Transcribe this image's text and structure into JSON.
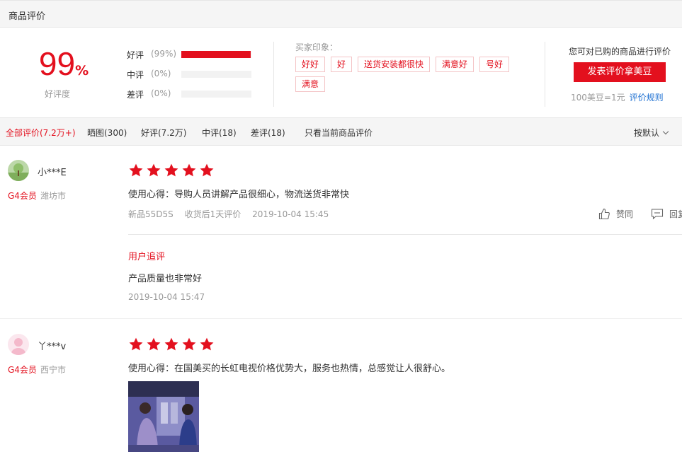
{
  "section_title": "商品评价",
  "summary": {
    "rate_value": "99",
    "rate_unit": "%",
    "rate_label": "好评度",
    "breakdown": [
      {
        "name": "好评",
        "percent_text": "(99%)",
        "fraction": 0.99
      },
      {
        "name": "中评",
        "percent_text": "(0%)",
        "fraction": 0
      },
      {
        "name": "差评",
        "percent_text": "(0%)",
        "fraction": 0
      }
    ],
    "impression_label": "买家印象：",
    "tags": [
      "好好",
      "好",
      "送货安装都很快",
      "满意好",
      "号好",
      "满意"
    ],
    "cta_hint": "您可对已购的商品进行评价",
    "cta_button": "发表评价拿美豆",
    "coin_note": "100美豆=1元",
    "rule_link": "评价规则"
  },
  "filters": [
    "全部评价(7.2万+)",
    "晒图(300)",
    "好评(7.2万)",
    "中评(18)",
    "差评(18)",
    "只看当前商品评价"
  ],
  "sort_label": "按默认",
  "reviews": [
    {
      "user": "小***E",
      "level": "G4会员",
      "city": "潍坊市",
      "stars": 5,
      "content": "使用心得：导购人员讲解产品很细心，物流送货非常快",
      "model": "新品55D5S",
      "after": "收货后1天评价",
      "time": "2019-10-04 15:45",
      "like": "赞同",
      "reply": "回复",
      "follow_title": "用户追评",
      "follow_content": "产品质量也非常好",
      "follow_time": "2019-10-04 15:47"
    },
    {
      "user": "丫***v",
      "level": "G4会员",
      "city": "西宁市",
      "stars": 5,
      "content": "使用心得：在国美买的长虹电视价格优势大，服务也热情，总感觉让人很舒心。"
    }
  ],
  "colors": {
    "accent": "#e3101e",
    "link": "#1b6ed1",
    "muted": "#999999"
  }
}
